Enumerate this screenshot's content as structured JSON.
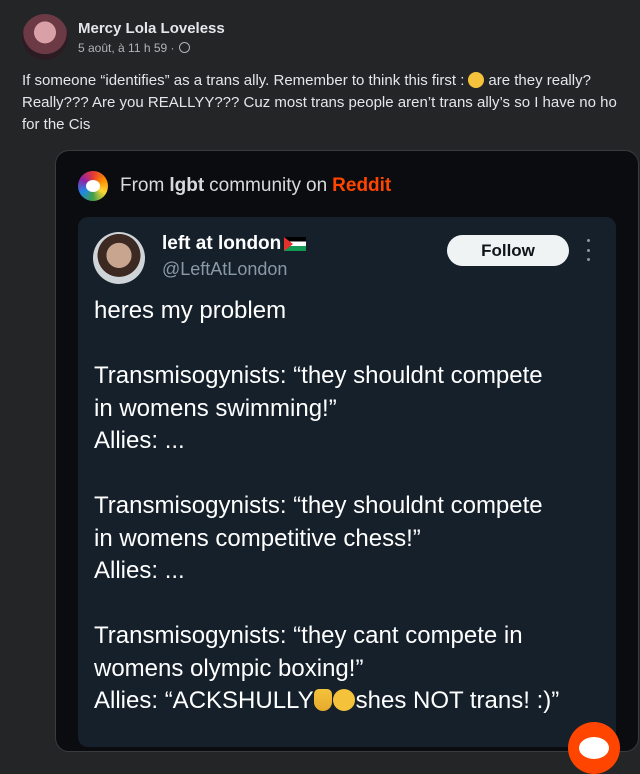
{
  "post": {
    "author": "Mercy Lola Loveless",
    "timestamp": "5 août, à 11 h 59 ·",
    "text_line1_a": "If someone “identifies” as a trans ally. Remember to think this first :",
    "text_line1_b": "are they really?",
    "text_line2": "Really??? Are you REALLYY??? Cuz most trans people aren’t trans ally’s so I have no ho",
    "text_line3": "for the Cis"
  },
  "embed": {
    "from": "From",
    "community": "lgbt",
    "community_suffix": "community",
    "on": "on",
    "platform": "Reddit"
  },
  "tweet": {
    "name": "left at london",
    "handle": "@LeftAtLondon",
    "follow_label": "Follow",
    "intro": "heres my problem",
    "block1_line1": "Transmisogynists: “they shouldnt compete",
    "block1_line2": "in womens swimming!”",
    "block1_line3": "Allies: ...",
    "block2_line1": "Transmisogynists: “they shouldnt compete",
    "block2_line2": "in womens competitive chess!”",
    "block2_line3": "Allies: ...",
    "block3_line1": "Transmisogynists: “they cant compete in",
    "block3_line2": "womens olympic boxing!”",
    "block3_line3_a": "Allies: “ACKSHULLY",
    "block3_line3_b": "shes NOT trans! :)”"
  },
  "icons": {
    "thinking": "thinking-face-icon",
    "globe": "globe-icon",
    "community": "rainbow-community-icon",
    "flag": "palestine-flag-icon",
    "more": "more-options-icon",
    "hand": "pointing-up-hand-icon",
    "smile": "smiling-face-icon",
    "reddit": "reddit-snoo-icon"
  },
  "colors": {
    "background": "#242526",
    "embed_background": "#0b0c0f",
    "tweet_background": "#15202b",
    "reddit_accent": "#ff4500"
  }
}
